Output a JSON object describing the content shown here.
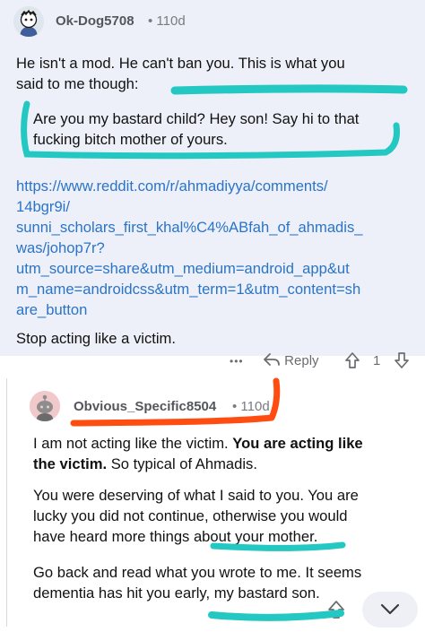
{
  "comment1": {
    "username": "Ok-Dog5708",
    "age": "• 110d",
    "paragraph1": "He isn't a mod. He can't ban you. This is what you\nsaid to me though:",
    "quote": "Are you my bastard child? Hey son! Say hi to that\nfucking bitch mother of yours.",
    "link": "https://www.reddit.com/r/ahmadiyya/comments/\n14bgr9i/\nsunni_scholars_first_khal%C4%ABfah_of_ahmadis_\nwas/johop7r?\nutm_source=share&utm_medium=android_app&ut\nm_name=androidcss&utm_term=1&utm_content=sh\nare_button",
    "paragraph2": "Stop acting like a victim.",
    "more": "•••",
    "reply_label": "Reply",
    "votes": "1"
  },
  "comment2": {
    "username": "Obvious_Specific8504",
    "age": "• 110d",
    "p1_a": "I am not acting like the victim. ",
    "p1_b": "You are acting like\nthe victim.",
    "p1_c": " So typical of Ahmadis.",
    "p2": "You were deserving of what I said to you. You are\nlucky you did not continue, otherwise you would\nhave heard more things about your mother.",
    "p3": "Go back and read what you wrote to me. It seems\ndementia has hit you early, my bastard son."
  },
  "colors": {
    "comment1_bg": "#eef0f9",
    "link": "#2a74c7",
    "highlight_teal": "#22c8c1",
    "highlight_orange": "#ff4d12"
  }
}
